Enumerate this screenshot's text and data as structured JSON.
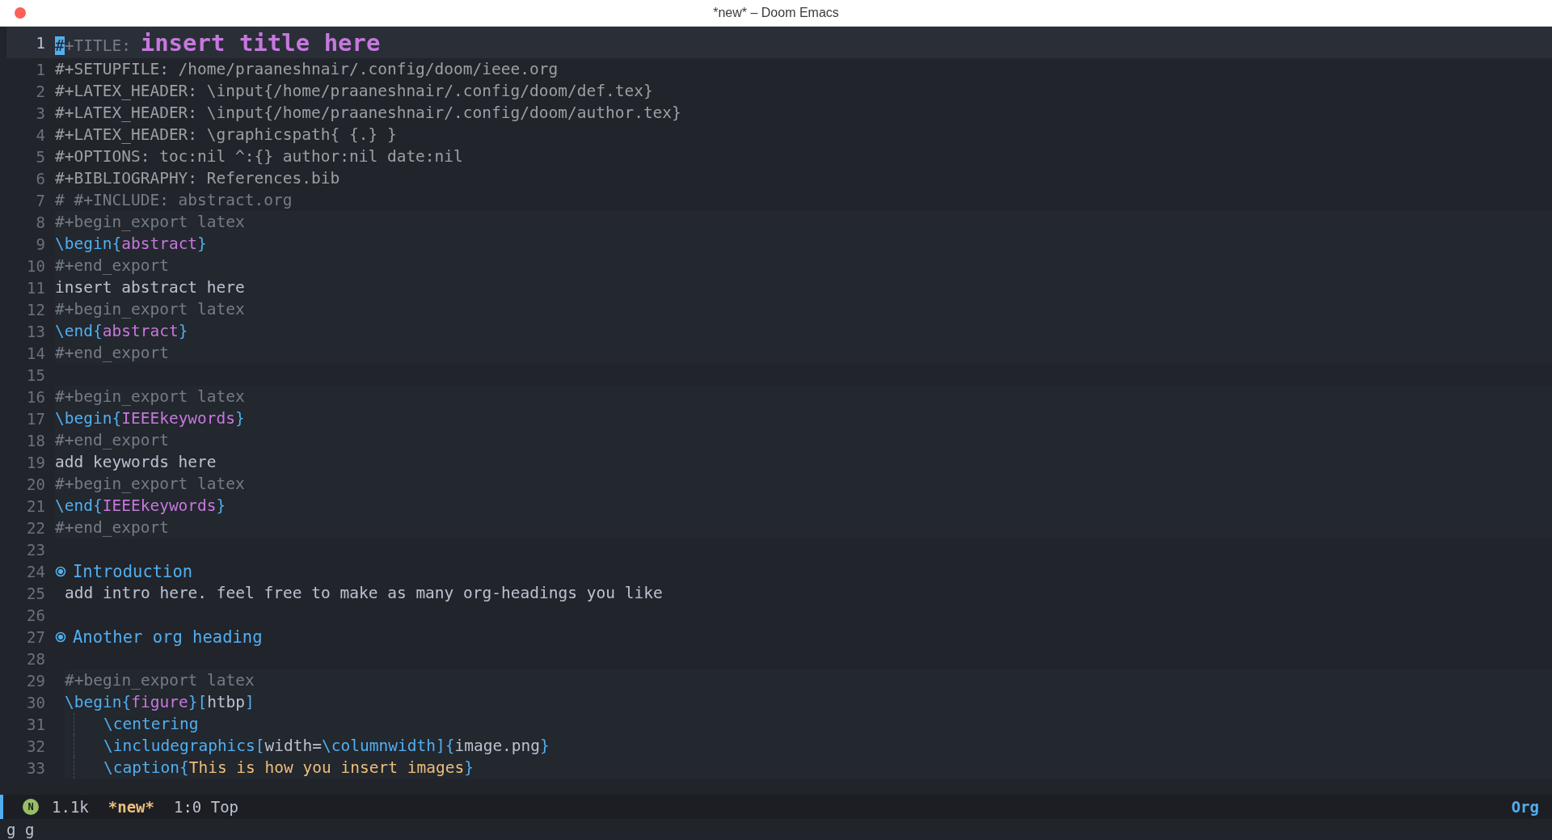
{
  "window": {
    "title": "*new* – Doom Emacs"
  },
  "editor": {
    "lines": [
      {
        "number": "1",
        "current": true,
        "block": false,
        "kind": "title",
        "tokens": [
          {
            "kind": "cursor",
            "text": "#"
          },
          {
            "kind": "comment",
            "text": "+TITLE: "
          },
          {
            "kind": "title",
            "text": "insert title here"
          }
        ]
      },
      {
        "number": "1",
        "current": false,
        "block": false,
        "kind": "code",
        "tokens": [
          {
            "kind": "meta",
            "text": "#+SETUPFILE: /home/praaneshnair/.config/doom/ieee.org"
          }
        ]
      },
      {
        "number": "2",
        "current": false,
        "block": false,
        "kind": "code",
        "tokens": [
          {
            "kind": "meta",
            "text": "#+LATEX_HEADER: \\input{/home/praaneshnair/.config/doom/def.tex}"
          }
        ]
      },
      {
        "number": "3",
        "current": false,
        "block": false,
        "kind": "code",
        "tokens": [
          {
            "kind": "meta",
            "text": "#+LATEX_HEADER: \\input{/home/praaneshnair/.config/doom/author.tex}"
          }
        ]
      },
      {
        "number": "4",
        "current": false,
        "block": false,
        "kind": "code",
        "tokens": [
          {
            "kind": "meta",
            "text": "#+LATEX_HEADER: \\graphicspath{ {.} }"
          }
        ]
      },
      {
        "number": "5",
        "current": false,
        "block": false,
        "kind": "code",
        "tokens": [
          {
            "kind": "meta",
            "text": "#+OPTIONS: toc:nil ^:{} author:nil date:nil"
          }
        ]
      },
      {
        "number": "6",
        "current": false,
        "block": false,
        "kind": "code",
        "tokens": [
          {
            "kind": "meta",
            "text": "#+BIBLIOGRAPHY: References.bib"
          }
        ]
      },
      {
        "number": "7",
        "current": false,
        "block": false,
        "kind": "code",
        "tokens": [
          {
            "kind": "comment",
            "text": "# #+INCLUDE: abstract.org"
          }
        ]
      },
      {
        "number": "8",
        "current": false,
        "block": true,
        "kind": "code",
        "tokens": [
          {
            "kind": "comment",
            "text": "#+begin_export latex"
          }
        ]
      },
      {
        "number": "9",
        "current": false,
        "block": true,
        "kind": "code",
        "tokens": [
          {
            "kind": "cmd",
            "text": "\\begin{"
          },
          {
            "kind": "arg",
            "text": "abstract"
          },
          {
            "kind": "cmd",
            "text": "}"
          }
        ]
      },
      {
        "number": "10",
        "current": false,
        "block": true,
        "kind": "code",
        "tokens": [
          {
            "kind": "comment",
            "text": "#+end_export"
          }
        ]
      },
      {
        "number": "11",
        "current": false,
        "block": true,
        "kind": "code",
        "tokens": [
          {
            "kind": "plain",
            "text": "insert abstract here"
          }
        ]
      },
      {
        "number": "12",
        "current": false,
        "block": true,
        "kind": "code",
        "tokens": [
          {
            "kind": "comment",
            "text": "#+begin_export latex"
          }
        ]
      },
      {
        "number": "13",
        "current": false,
        "block": true,
        "kind": "code",
        "tokens": [
          {
            "kind": "cmd",
            "text": "\\end{"
          },
          {
            "kind": "arg",
            "text": "abstract"
          },
          {
            "kind": "cmd",
            "text": "}"
          }
        ]
      },
      {
        "number": "14",
        "current": false,
        "block": true,
        "kind": "code",
        "tokens": [
          {
            "kind": "comment",
            "text": "#+end_export"
          }
        ]
      },
      {
        "number": "15",
        "current": false,
        "block": false,
        "kind": "blank"
      },
      {
        "number": "16",
        "current": false,
        "block": true,
        "kind": "code",
        "tokens": [
          {
            "kind": "comment",
            "text": "#+begin_export latex"
          }
        ]
      },
      {
        "number": "17",
        "current": false,
        "block": true,
        "kind": "code",
        "tokens": [
          {
            "kind": "cmd",
            "text": "\\begin{"
          },
          {
            "kind": "arg",
            "text": "IEEEkeywords"
          },
          {
            "kind": "cmd",
            "text": "}"
          }
        ]
      },
      {
        "number": "18",
        "current": false,
        "block": true,
        "kind": "code",
        "tokens": [
          {
            "kind": "comment",
            "text": "#+end_export"
          }
        ]
      },
      {
        "number": "19",
        "current": false,
        "block": true,
        "kind": "code",
        "tokens": [
          {
            "kind": "plain",
            "text": "add keywords here"
          }
        ]
      },
      {
        "number": "20",
        "current": false,
        "block": true,
        "kind": "code",
        "tokens": [
          {
            "kind": "comment",
            "text": "#+begin_export latex"
          }
        ]
      },
      {
        "number": "21",
        "current": false,
        "block": true,
        "kind": "code",
        "tokens": [
          {
            "kind": "cmd",
            "text": "\\end{"
          },
          {
            "kind": "arg",
            "text": "IEEEkeywords"
          },
          {
            "kind": "cmd",
            "text": "}"
          }
        ]
      },
      {
        "number": "22",
        "current": false,
        "block": true,
        "kind": "code",
        "tokens": [
          {
            "kind": "comment",
            "text": "#+end_export"
          }
        ]
      },
      {
        "number": "23",
        "current": false,
        "block": false,
        "kind": "blank"
      },
      {
        "number": "24",
        "current": false,
        "block": false,
        "kind": "heading",
        "text": "Introduction",
        "children": [
          {
            "number": "25",
            "current": false,
            "block": false,
            "kind": "code",
            "tokens": [
              {
                "kind": "plain",
                "text": "add intro here. feel free to make as many org-headings you like"
              }
            ]
          },
          {
            "number": "26",
            "current": false,
            "block": false,
            "kind": "blank"
          }
        ]
      },
      {
        "number": "27",
        "current": false,
        "block": false,
        "kind": "heading",
        "text": "Another org heading",
        "children": [
          {
            "number": "28",
            "current": false,
            "block": false,
            "kind": "blank"
          },
          {
            "number": "29",
            "current": false,
            "block": true,
            "kind": "code",
            "tokens": [
              {
                "kind": "comment",
                "text": "#+begin_export latex"
              }
            ]
          },
          {
            "number": "30",
            "current": false,
            "block": true,
            "kind": "code",
            "tokens": [
              {
                "kind": "cmd",
                "text": "\\begin{"
              },
              {
                "kind": "arg",
                "text": "figure"
              },
              {
                "kind": "cmd",
                "text": "}["
              },
              {
                "kind": "plain",
                "text": "htbp"
              },
              {
                "kind": "cmd",
                "text": "]"
              }
            ],
            "children": [
              {
                "number": "31",
                "current": false,
                "block": true,
                "kind": "code",
                "tokens": [
                  {
                    "kind": "cmd",
                    "text": "\\centering"
                  }
                ]
              },
              {
                "number": "32",
                "current": false,
                "block": true,
                "kind": "code",
                "tokens": [
                  {
                    "kind": "cmd",
                    "text": "\\includegraphics["
                  },
                  {
                    "kind": "plain",
                    "text": "width="
                  },
                  {
                    "kind": "cmd",
                    "text": "\\columnwidth]{"
                  },
                  {
                    "kind": "plain",
                    "text": "image.png"
                  },
                  {
                    "kind": "cmd",
                    "text": "}"
                  }
                ]
              },
              {
                "number": "33",
                "current": false,
                "block": true,
                "kind": "code",
                "tokens": [
                  {
                    "kind": "cmd",
                    "text": "\\caption{"
                  },
                  {
                    "kind": "string",
                    "text": "This is how you insert images"
                  },
                  {
                    "kind": "cmd",
                    "text": "}"
                  }
                ]
              }
            ]
          }
        ]
      }
    ]
  },
  "mode_line": {
    "state": "N",
    "size": "1.1k",
    "buffer": "*new*",
    "position": "1:0 Top",
    "mode": "Org"
  },
  "echo_area": "g g"
}
